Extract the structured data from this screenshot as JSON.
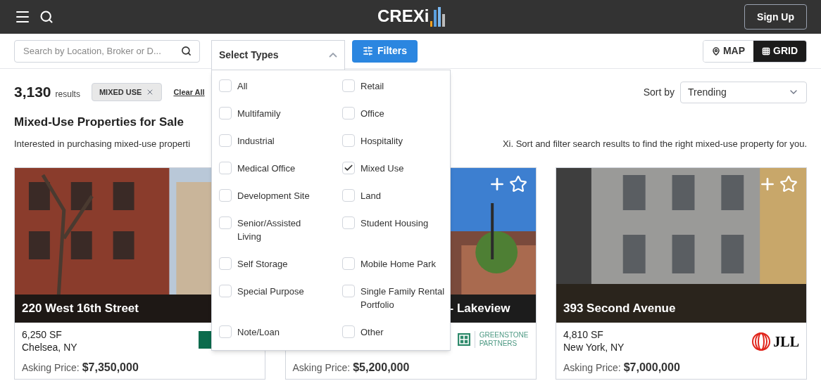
{
  "header": {
    "logo": "CREXi",
    "sign_up": "Sign Up"
  },
  "toolbar": {
    "search": {
      "placeholder": "Search by Location, Broker or D..."
    },
    "types_select": {
      "label": "Select Types",
      "expanded": true
    },
    "filters": "Filters",
    "views": [
      {
        "label": "MAP",
        "kind": "map",
        "selected": false
      },
      {
        "label": "GRID",
        "kind": "grid",
        "selected": true
      }
    ]
  },
  "results": {
    "count": "3,130",
    "unit": "results",
    "chips": [
      "MIXED USE"
    ],
    "clear": "Clear All",
    "sort_label": "Sort by",
    "sort_value": "Trending"
  },
  "heading": "Mixed-Use Properties for Sale",
  "description": {
    "left": "Interested in purchasing mixed-use properti",
    "right": "Xi. Sort and filter search results to find the right mixed-use property for you."
  },
  "types": {
    "columns": [
      [
        {
          "label": "All",
          "checked": false
        },
        {
          "label": "Multifamily",
          "checked": false
        },
        {
          "label": "Industrial",
          "checked": false
        },
        {
          "label": "Medical Office",
          "checked": false
        },
        {
          "label": "Development Site",
          "checked": false
        },
        {
          "label": "Senior/Assisted Living",
          "checked": false
        },
        {
          "label": "Self Storage",
          "checked": false
        },
        {
          "label": "Special Purpose",
          "checked": false
        },
        {
          "label": "Note/Loan",
          "checked": false
        }
      ],
      [
        {
          "label": "Retail",
          "checked": false
        },
        {
          "label": "Office",
          "checked": false
        },
        {
          "label": "Hospitality",
          "checked": false
        },
        {
          "label": "Mixed Use",
          "checked": true
        },
        {
          "label": "Land",
          "checked": false
        },
        {
          "label": "Student Housing",
          "checked": false
        },
        {
          "label": "Mobile Home Park",
          "checked": false
        },
        {
          "label": "Single Family Rental Portfolio",
          "checked": false
        },
        {
          "label": "Other",
          "checked": false
        }
      ]
    ]
  },
  "cards": [
    {
      "title": "220 West 16th Street",
      "title_cut_start": false,
      "actions_visible": false,
      "size": "6,250 SF",
      "location": "Chelsea, NY",
      "price_label": "Asking Price:",
      "price": "$7,350,000",
      "kind": "green"
    },
    {
      "title": "- Lakeview",
      "title_cut_start": true,
      "actions_visible": true,
      "price_label": "Asking Price:",
      "price": "$5,200,000",
      "kind": "greenstone",
      "logo_lines": [
        "GREENSTONE",
        "PARTNERS"
      ]
    },
    {
      "title": "393 Second Avenue",
      "title_cut_start": false,
      "actions_visible": true,
      "size": "4,810 SF",
      "location": "New York, NY",
      "price_label": "Asking Price:",
      "price": "$7,000,000",
      "kind": "jll",
      "logo_lines": [
        "JLL"
      ]
    }
  ]
}
